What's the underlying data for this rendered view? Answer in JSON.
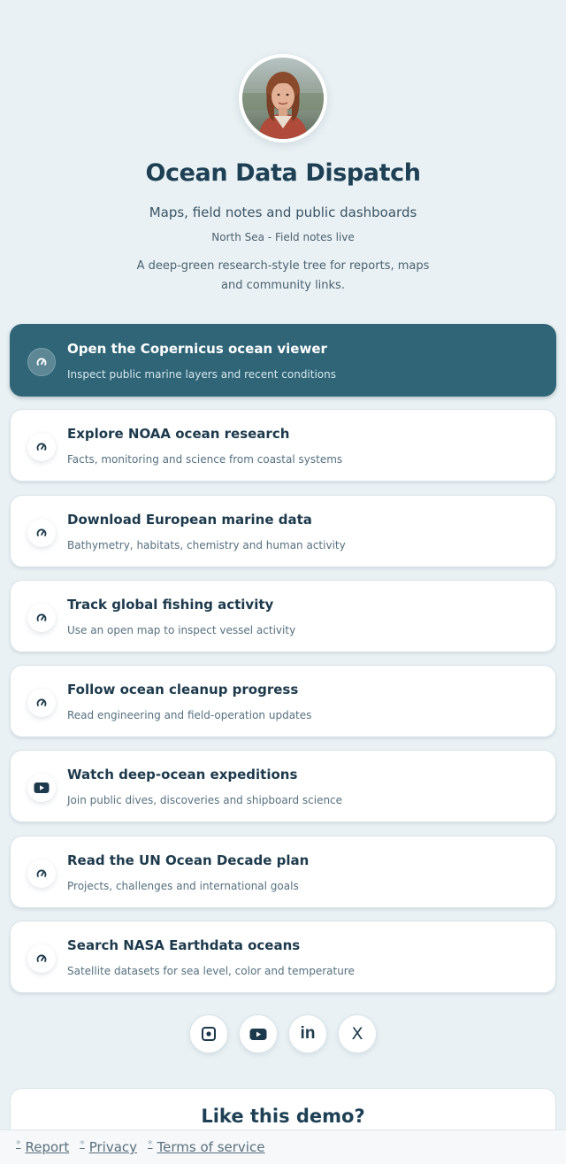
{
  "profile": {
    "name": "Ocean Data Dispatch",
    "subtitle": "Maps, field notes and public dashboards",
    "location": "North Sea - Field notes live",
    "description": "A deep-green research-style tree for reports, maps and community links."
  },
  "links": [
    {
      "title": "Open the Copernicus ocean viewer",
      "subtitle": "Inspect public marine layers and recent conditions",
      "icon": "gauge-icon",
      "featured": true
    },
    {
      "title": "Explore NOAA ocean research",
      "subtitle": "Facts, monitoring and science from coastal systems",
      "icon": "gauge-icon"
    },
    {
      "title": "Download European marine data",
      "subtitle": "Bathymetry, habitats, chemistry and human activity",
      "icon": "gauge-icon"
    },
    {
      "title": "Track global fishing activity",
      "subtitle": "Use an open map to inspect vessel activity",
      "icon": "gauge-icon"
    },
    {
      "title": "Follow ocean cleanup progress",
      "subtitle": "Read engineering and field-operation updates",
      "icon": "gauge-icon"
    },
    {
      "title": "Watch deep-ocean expeditions",
      "subtitle": "Join public dives, discoveries and shipboard science",
      "icon": "youtube-icon"
    },
    {
      "title": "Read the UN Ocean Decade plan",
      "subtitle": "Projects, challenges and international goals",
      "icon": "gauge-icon"
    },
    {
      "title": "Search NASA Earthdata oceans",
      "subtitle": "Satellite datasets for sea level, color and temperature",
      "icon": "gauge-icon"
    }
  ],
  "socials": [
    {
      "icon": "instagram-icon"
    },
    {
      "icon": "youtube-icon"
    },
    {
      "icon": "linkedin-icon",
      "text": "in"
    },
    {
      "icon": "x-icon",
      "text": "X"
    }
  ],
  "demo": {
    "title": "Like this demo?"
  },
  "footer": {
    "star": "*",
    "links": [
      "Report",
      "Privacy",
      "Terms of service"
    ]
  },
  "colors": {
    "background": "#e9f1f4",
    "accent": "#2f6577",
    "heading": "#1e4055"
  }
}
